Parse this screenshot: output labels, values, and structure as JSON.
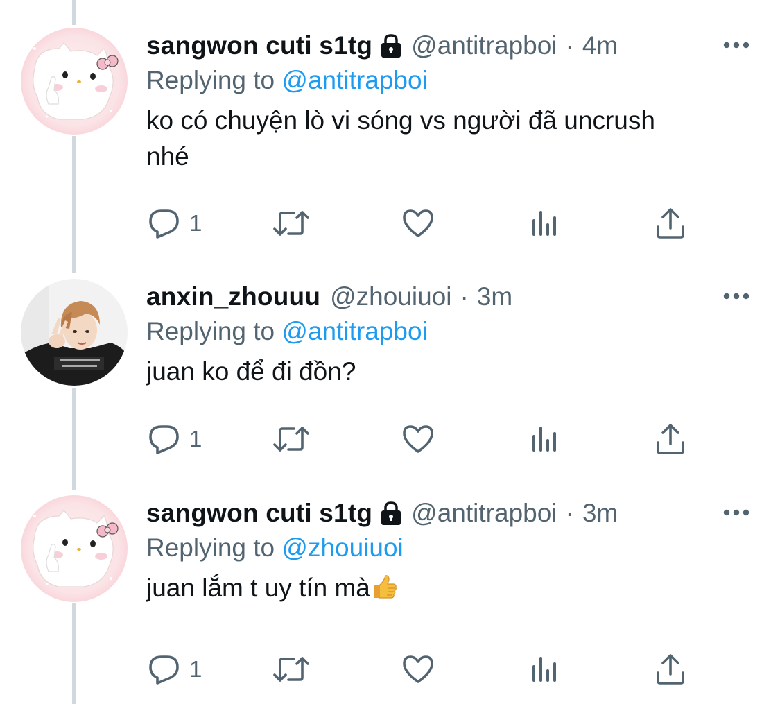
{
  "tweets": [
    {
      "display_name": "sangwon cuti s1tg",
      "protected": true,
      "handle": "@antitrapboi",
      "separator": "·",
      "time": "4m",
      "replying_prefix": "Replying to",
      "replying_to": "@antitrapboi",
      "text": "ko có chuyện lò vi sóng vs người đã uncrush nhé",
      "reply_count": "1",
      "avatar": "hello-kitty-avatar"
    },
    {
      "display_name": "anxin_zhouuu",
      "protected": false,
      "handle": "@zhouiuoi",
      "separator": "·",
      "time": "3m",
      "replying_prefix": "Replying to",
      "replying_to": "@antitrapboi",
      "text": "juan ko để đi đồn?",
      "reply_count": "1",
      "avatar": "person-photo-avatar"
    },
    {
      "display_name": "sangwon cuti s1tg",
      "protected": true,
      "handle": "@antitrapboi",
      "separator": "·",
      "time": "3m",
      "replying_prefix": "Replying to",
      "replying_to": "@zhouiuoi",
      "text": "juan lắm t uy tín mà",
      "reply_count": "1",
      "avatar": "hello-kitty-avatar"
    }
  ],
  "colors": {
    "text": "#0f1419",
    "secondary": "#536471",
    "link": "#1d9bf0",
    "thread_line": "#cfd9de"
  },
  "icons": [
    "lock-icon",
    "more-icon",
    "reply-icon",
    "retweet-icon",
    "like-icon",
    "views-icon",
    "share-icon",
    "thumbs-up-emoji"
  ]
}
